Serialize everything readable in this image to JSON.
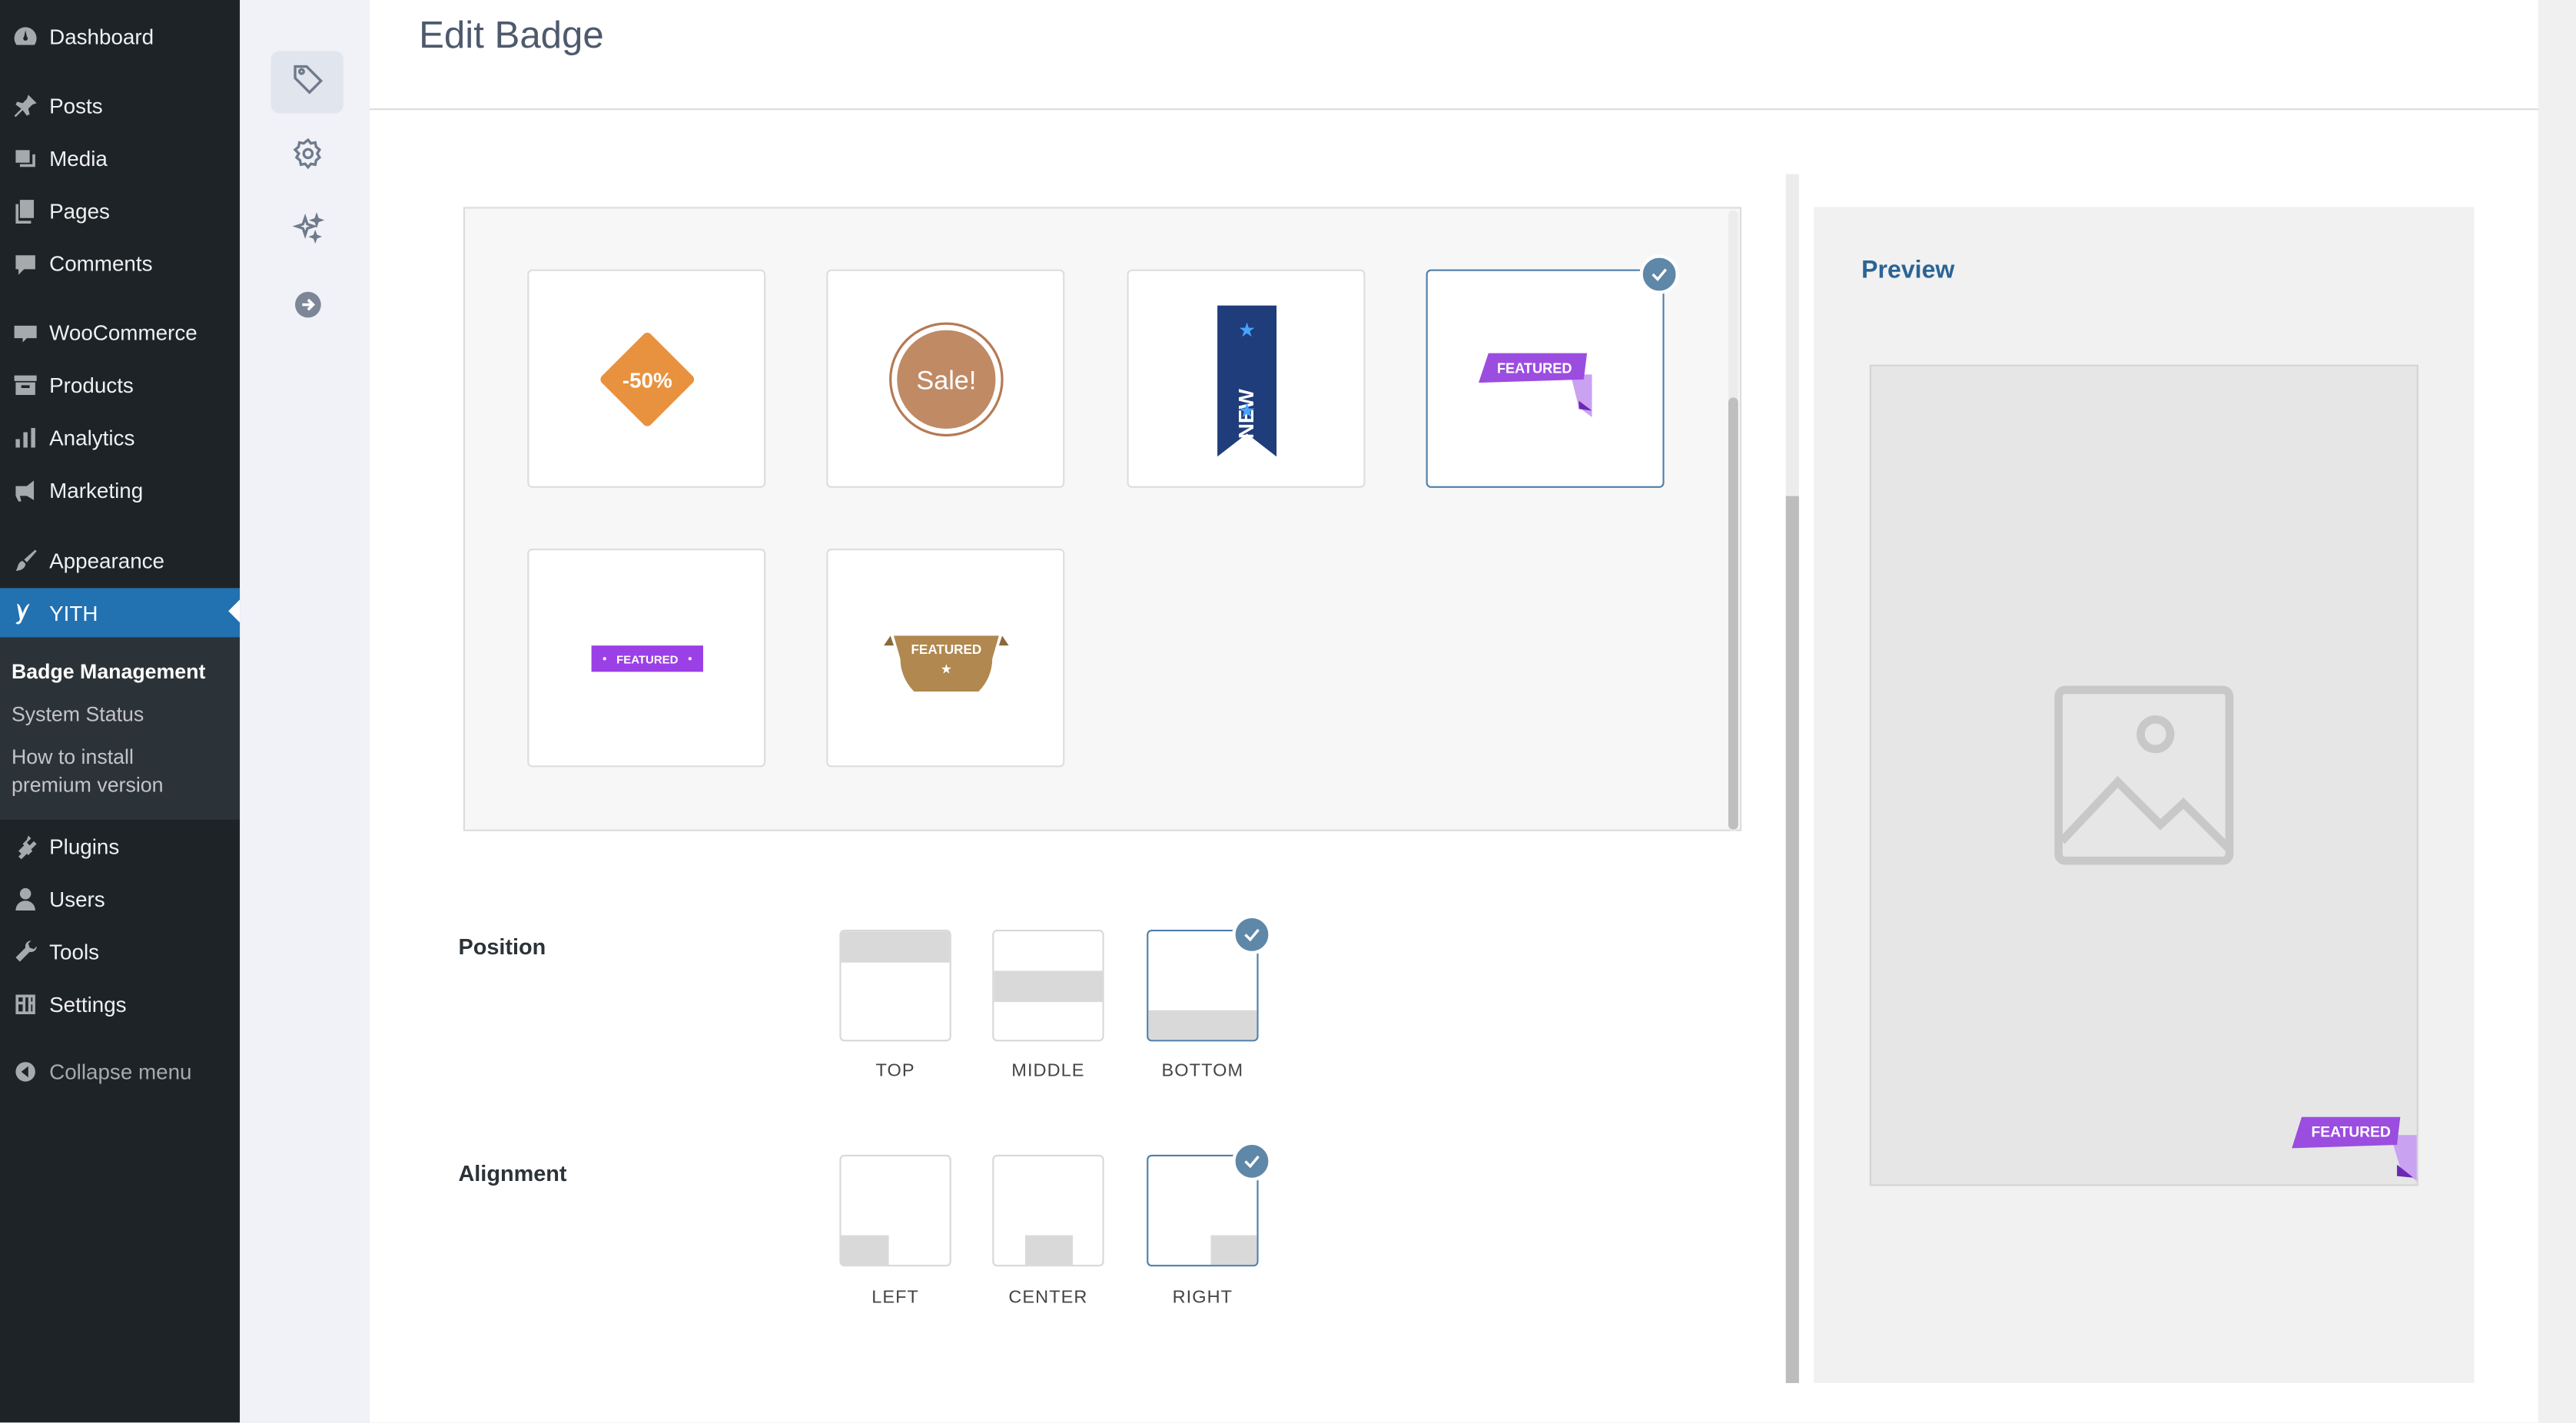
{
  "sidebar": {
    "items": [
      {
        "label": "Dashboard",
        "icon": "dashboard-icon"
      },
      {
        "label": "Posts",
        "icon": "pin-icon"
      },
      {
        "label": "Media",
        "icon": "media-icon"
      },
      {
        "label": "Pages",
        "icon": "pages-icon"
      },
      {
        "label": "Comments",
        "icon": "comment-icon"
      },
      {
        "label": "WooCommerce",
        "icon": "woo-icon"
      },
      {
        "label": "Products",
        "icon": "archive-icon"
      },
      {
        "label": "Analytics",
        "icon": "bar-chart-icon"
      },
      {
        "label": "Marketing",
        "icon": "megaphone-icon"
      },
      {
        "label": "Appearance",
        "icon": "brush-icon"
      },
      {
        "label": "YITH",
        "icon": "yith-icon"
      },
      {
        "label": "Plugins",
        "icon": "plugin-icon"
      },
      {
        "label": "Users",
        "icon": "user-icon"
      },
      {
        "label": "Tools",
        "icon": "wrench-icon"
      },
      {
        "label": "Settings",
        "icon": "settings-icon"
      }
    ],
    "submenu": [
      "Badge Management",
      "System Status",
      "How to install",
      "premium version"
    ],
    "collapse": "Collapse menu"
  },
  "rail": {
    "icons": [
      "tag-icon",
      "gear-icon",
      "sparkles-icon",
      "arrow-right-circle-icon"
    ]
  },
  "page": {
    "title": "Edit Badge"
  },
  "badges": {
    "b1": "-50%",
    "b2": "Sale!",
    "b3": "NEW",
    "b4": "FEATURED",
    "b5": "FEATURED",
    "b6": "FEATURED",
    "selected_index": 3
  },
  "position": {
    "label": "Position",
    "options": [
      "TOP",
      "MIDDLE",
      "BOTTOM"
    ],
    "selected": "BOTTOM"
  },
  "alignment": {
    "label": "Alignment",
    "options": [
      "LEFT",
      "CENTER",
      "RIGHT"
    ],
    "selected": "RIGHT"
  },
  "preview": {
    "title": "Preview",
    "badge": "FEATURED"
  },
  "colors": {
    "sidebar_bg": "#1d2327",
    "active_menu": "#2271b1",
    "selected_border": "#4f7ea8",
    "check_bg": "#5f87a7",
    "preview_title": "#2a6496",
    "badge_purple": "#9b4de0",
    "badge_orange": "#e8923f"
  }
}
